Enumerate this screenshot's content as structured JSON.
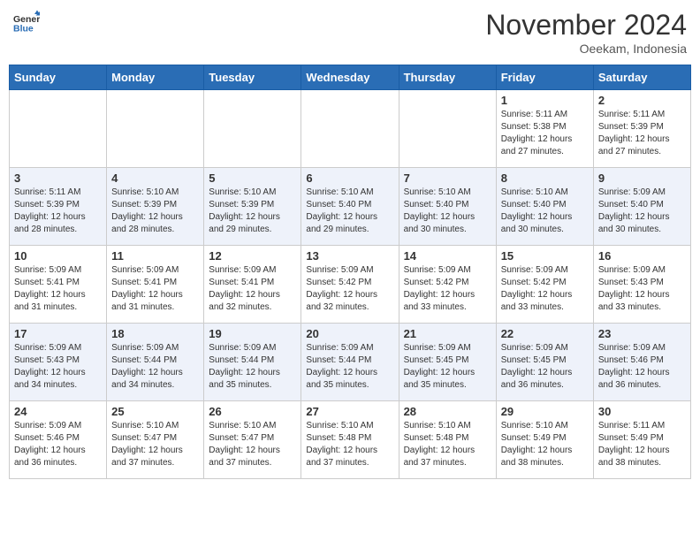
{
  "header": {
    "logo_general": "General",
    "logo_blue": "Blue",
    "month_title": "November 2024",
    "location": "Oeekam, Indonesia"
  },
  "days_of_week": [
    "Sunday",
    "Monday",
    "Tuesday",
    "Wednesday",
    "Thursday",
    "Friday",
    "Saturday"
  ],
  "weeks": [
    {
      "days": [
        {
          "number": "",
          "info": ""
        },
        {
          "number": "",
          "info": ""
        },
        {
          "number": "",
          "info": ""
        },
        {
          "number": "",
          "info": ""
        },
        {
          "number": "",
          "info": ""
        },
        {
          "number": "1",
          "info": "Sunrise: 5:11 AM\nSunset: 5:38 PM\nDaylight: 12 hours\nand 27 minutes."
        },
        {
          "number": "2",
          "info": "Sunrise: 5:11 AM\nSunset: 5:39 PM\nDaylight: 12 hours\nand 27 minutes."
        }
      ]
    },
    {
      "days": [
        {
          "number": "3",
          "info": "Sunrise: 5:11 AM\nSunset: 5:39 PM\nDaylight: 12 hours\nand 28 minutes."
        },
        {
          "number": "4",
          "info": "Sunrise: 5:10 AM\nSunset: 5:39 PM\nDaylight: 12 hours\nand 28 minutes."
        },
        {
          "number": "5",
          "info": "Sunrise: 5:10 AM\nSunset: 5:39 PM\nDaylight: 12 hours\nand 29 minutes."
        },
        {
          "number": "6",
          "info": "Sunrise: 5:10 AM\nSunset: 5:40 PM\nDaylight: 12 hours\nand 29 minutes."
        },
        {
          "number": "7",
          "info": "Sunrise: 5:10 AM\nSunset: 5:40 PM\nDaylight: 12 hours\nand 30 minutes."
        },
        {
          "number": "8",
          "info": "Sunrise: 5:10 AM\nSunset: 5:40 PM\nDaylight: 12 hours\nand 30 minutes."
        },
        {
          "number": "9",
          "info": "Sunrise: 5:09 AM\nSunset: 5:40 PM\nDaylight: 12 hours\nand 30 minutes."
        }
      ]
    },
    {
      "days": [
        {
          "number": "10",
          "info": "Sunrise: 5:09 AM\nSunset: 5:41 PM\nDaylight: 12 hours\nand 31 minutes."
        },
        {
          "number": "11",
          "info": "Sunrise: 5:09 AM\nSunset: 5:41 PM\nDaylight: 12 hours\nand 31 minutes."
        },
        {
          "number": "12",
          "info": "Sunrise: 5:09 AM\nSunset: 5:41 PM\nDaylight: 12 hours\nand 32 minutes."
        },
        {
          "number": "13",
          "info": "Sunrise: 5:09 AM\nSunset: 5:42 PM\nDaylight: 12 hours\nand 32 minutes."
        },
        {
          "number": "14",
          "info": "Sunrise: 5:09 AM\nSunset: 5:42 PM\nDaylight: 12 hours\nand 33 minutes."
        },
        {
          "number": "15",
          "info": "Sunrise: 5:09 AM\nSunset: 5:42 PM\nDaylight: 12 hours\nand 33 minutes."
        },
        {
          "number": "16",
          "info": "Sunrise: 5:09 AM\nSunset: 5:43 PM\nDaylight: 12 hours\nand 33 minutes."
        }
      ]
    },
    {
      "days": [
        {
          "number": "17",
          "info": "Sunrise: 5:09 AM\nSunset: 5:43 PM\nDaylight: 12 hours\nand 34 minutes."
        },
        {
          "number": "18",
          "info": "Sunrise: 5:09 AM\nSunset: 5:44 PM\nDaylight: 12 hours\nand 34 minutes."
        },
        {
          "number": "19",
          "info": "Sunrise: 5:09 AM\nSunset: 5:44 PM\nDaylight: 12 hours\nand 35 minutes."
        },
        {
          "number": "20",
          "info": "Sunrise: 5:09 AM\nSunset: 5:44 PM\nDaylight: 12 hours\nand 35 minutes."
        },
        {
          "number": "21",
          "info": "Sunrise: 5:09 AM\nSunset: 5:45 PM\nDaylight: 12 hours\nand 35 minutes."
        },
        {
          "number": "22",
          "info": "Sunrise: 5:09 AM\nSunset: 5:45 PM\nDaylight: 12 hours\nand 36 minutes."
        },
        {
          "number": "23",
          "info": "Sunrise: 5:09 AM\nSunset: 5:46 PM\nDaylight: 12 hours\nand 36 minutes."
        }
      ]
    },
    {
      "days": [
        {
          "number": "24",
          "info": "Sunrise: 5:09 AM\nSunset: 5:46 PM\nDaylight: 12 hours\nand 36 minutes."
        },
        {
          "number": "25",
          "info": "Sunrise: 5:10 AM\nSunset: 5:47 PM\nDaylight: 12 hours\nand 37 minutes."
        },
        {
          "number": "26",
          "info": "Sunrise: 5:10 AM\nSunset: 5:47 PM\nDaylight: 12 hours\nand 37 minutes."
        },
        {
          "number": "27",
          "info": "Sunrise: 5:10 AM\nSunset: 5:48 PM\nDaylight: 12 hours\nand 37 minutes."
        },
        {
          "number": "28",
          "info": "Sunrise: 5:10 AM\nSunset: 5:48 PM\nDaylight: 12 hours\nand 37 minutes."
        },
        {
          "number": "29",
          "info": "Sunrise: 5:10 AM\nSunset: 5:49 PM\nDaylight: 12 hours\nand 38 minutes."
        },
        {
          "number": "30",
          "info": "Sunrise: 5:11 AM\nSunset: 5:49 PM\nDaylight: 12 hours\nand 38 minutes."
        }
      ]
    }
  ]
}
